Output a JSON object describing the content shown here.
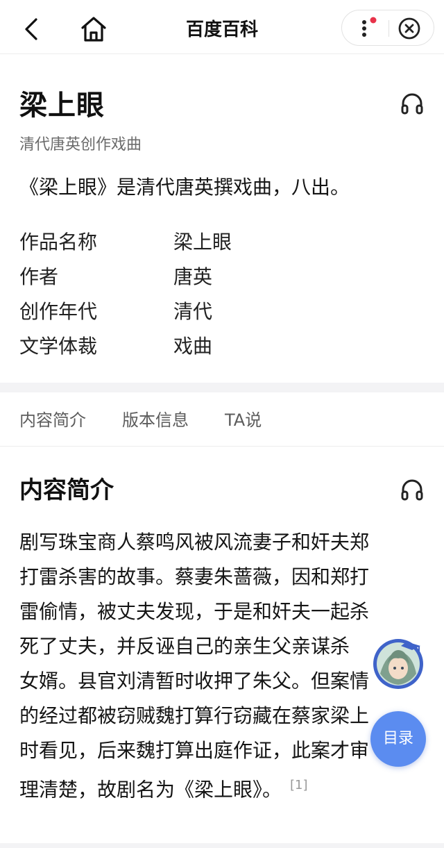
{
  "nav": {
    "title": "百度百科",
    "icons": {
      "back": "back-arrow-icon",
      "home": "home-icon",
      "more": "more-dots-icon",
      "close": "close-circle-icon"
    },
    "accent": "#e8334a"
  },
  "entry": {
    "title": "梁上眼",
    "subtitle": "清代唐英创作戏曲",
    "summary": "《梁上眼》是清代唐英撰戏曲，八出。",
    "info": [
      {
        "label": "作品名称",
        "value": "梁上眼"
      },
      {
        "label": "作者",
        "value": "唐英"
      },
      {
        "label": "创作年代",
        "value": "清代"
      },
      {
        "label": "文学体裁",
        "value": "戏曲"
      }
    ]
  },
  "tabs": [
    {
      "label": "内容简介"
    },
    {
      "label": "版本信息"
    },
    {
      "label": "TA说"
    }
  ],
  "section": {
    "title": "内容简介",
    "lines": [
      "剧写珠宝商人蔡鸣风被风流妻子和奸夫郑",
      "打雷杀害的故事。蔡妻朱蔷薇，因和郑打",
      "雷偷情，被丈夫发现，于是和奸夫一起杀",
      "死了丈夫，并反诬自己的亲生父亲谋杀",
      "女婿。县官刘清暂时收押了朱父。但案情",
      "的经过都被窃贼魏打算行窃藏在蔡家梁上",
      "时看见，后来魏打算出庭作证，此案才审",
      "理清楚，故剧名为《梁上眼》。"
    ],
    "ref": "[1]"
  },
  "floating": {
    "toc_label": "目录",
    "avatar_icon": "assistant-avatar-icon",
    "toc_color": "#5b8cf0"
  }
}
